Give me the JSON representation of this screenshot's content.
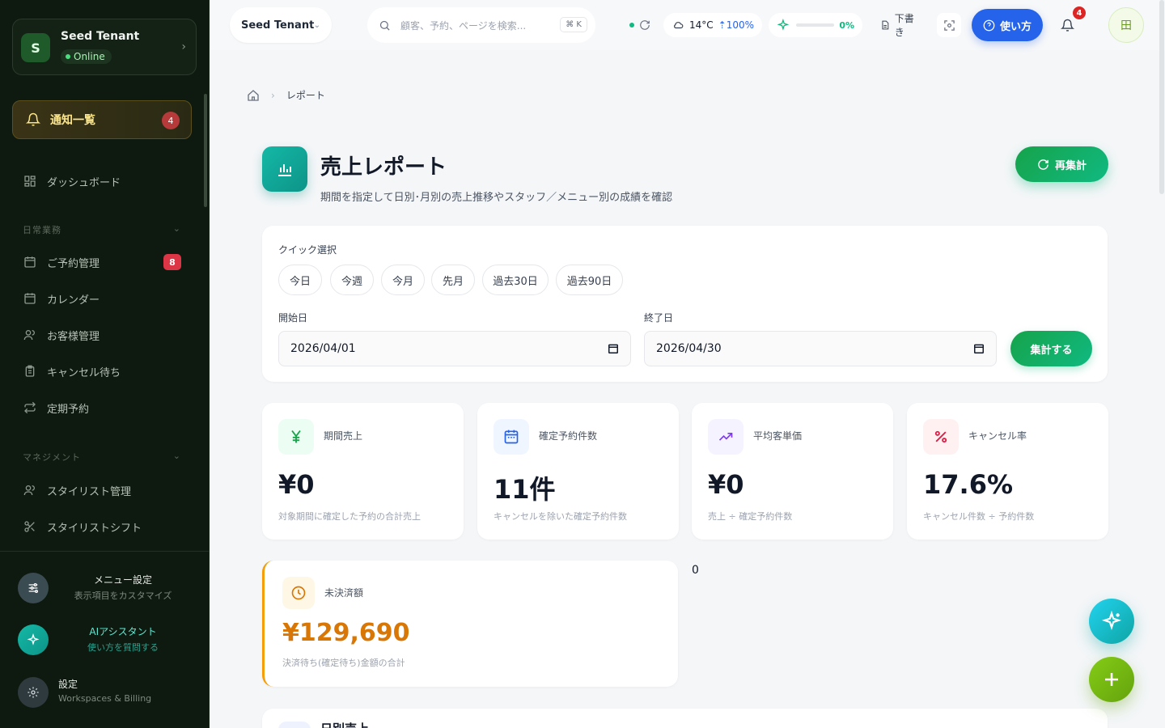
{
  "sidebar": {
    "tenant_name": "Seed Tenant",
    "tenant_initial": "S",
    "tenant_status": "Online",
    "notifications_label": "通知一覧",
    "notifications_count": "4",
    "dashboard_label": "ダッシュボード",
    "section_daily": "日常業務",
    "items_daily": [
      {
        "label": "ご予約管理",
        "badge": "8",
        "icon": "calendar-icon"
      },
      {
        "label": "カレンダー",
        "icon": "calendar-icon"
      },
      {
        "label": "お客様管理",
        "icon": "users-icon"
      },
      {
        "label": "キャンセル待ち",
        "icon": "clipboard-icon"
      },
      {
        "label": "定期予約",
        "icon": "repeat-icon"
      }
    ],
    "section_management": "マネジメント",
    "items_management": [
      {
        "label": "スタイリスト管理",
        "icon": "users-icon"
      },
      {
        "label": "スタイリストシフト",
        "icon": "scissors-icon"
      }
    ],
    "footer": {
      "menu_title": "メニュー設定",
      "menu_sub": "表示項目をカスタマイズ",
      "ai_title": "AIアシスタント",
      "ai_sub": "使い方を質問する",
      "settings_title": "設定",
      "settings_sub": "Workspaces & Billing"
    }
  },
  "topbar": {
    "tenant": "Seed Tenant",
    "search_placeholder": "顧客、予約、ページを検索...",
    "search_kbd": "⌘ K",
    "weather_temp": "14°C",
    "weather_humidity": "100%",
    "progress_pct": "0%",
    "progress_value": 0,
    "draft_label": "下書き",
    "help_label": "使い方",
    "bell_count": "4",
    "grid_icon": "田"
  },
  "breadcrumb": {
    "current": "レポート"
  },
  "page": {
    "title": "売上レポート",
    "subtitle": "期間を指定して日別･月別の売上推移やスタッフ／メニュー別の成績を確認",
    "recalc_label": "再集計"
  },
  "filter": {
    "quick_label": "クイック選択",
    "chips": [
      "今日",
      "今週",
      "今月",
      "先月",
      "過去30日",
      "過去90日"
    ],
    "start_label": "開始日",
    "start_value": "2026/04/01",
    "end_label": "終了日",
    "end_value": "2026/04/30",
    "aggregate_label": "集計する"
  },
  "stats": [
    {
      "label": "期間売上",
      "value": "¥0",
      "desc": "対象期間に確定した予約の合計売上",
      "color": "#16a34a"
    },
    {
      "label": "確定予約件数",
      "value": "11件",
      "desc": "キャンセルを除いた確定予約件数",
      "color": "#2563eb"
    },
    {
      "label": "平均客単価",
      "value": "¥0",
      "desc": "売上 ÷ 確定予約件数",
      "color": "#7c3aed"
    },
    {
      "label": "キャンセル率",
      "value": "17.6%",
      "desc": "キャンセル件数 ÷ 予約件数",
      "color": "#e11d48"
    }
  ],
  "unpaid": {
    "label": "未決済額",
    "value": "¥129,690",
    "desc": "決済待ち(確定待ち)金額の合計",
    "color": "#d97706"
  },
  "stray_value": "0",
  "daily_title": "日別売上"
}
